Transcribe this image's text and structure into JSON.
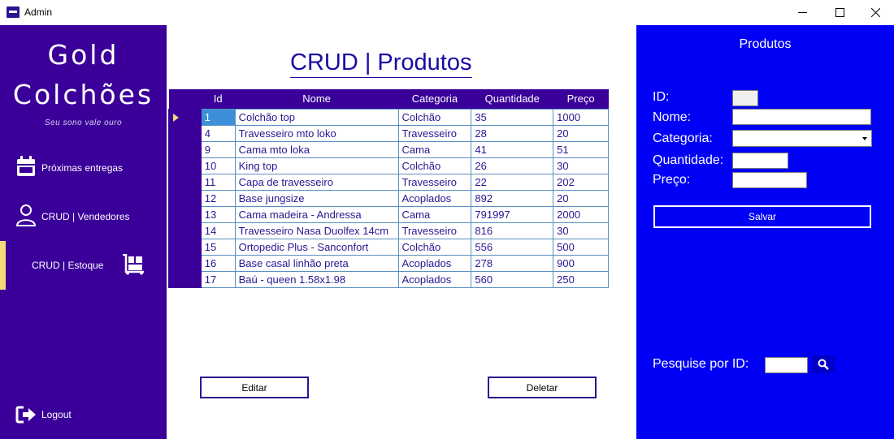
{
  "window": {
    "title": "Admin"
  },
  "sidebar": {
    "brand_line1": "Gold",
    "brand_line2": "Colchões",
    "tagline": "Seu sono vale ouro",
    "items": [
      {
        "label": "Próximas entregas",
        "icon": "calendar-icon",
        "active": false
      },
      {
        "label": "CRUD | Vendedores",
        "icon": "user-icon",
        "active": false
      },
      {
        "label": "CRUD | Estoque",
        "icon": "dolly-icon",
        "active": true
      }
    ],
    "logout_label": "Logout",
    "bg_color": "#3a0099",
    "active_marker_color": "#f5d97a"
  },
  "main": {
    "title": "CRUD | Produtos",
    "columns": [
      "Id",
      "Nome",
      "Categoria",
      "Quantidade",
      "Preço"
    ],
    "rows": [
      [
        "1",
        "Colchão top",
        "Colchão",
        "35",
        "1000"
      ],
      [
        "4",
        "Travesseiro mto loko",
        "Travesseiro",
        "28",
        "20"
      ],
      [
        "9",
        "Cama mto loka",
        "Cama",
        "41",
        "51"
      ],
      [
        "10",
        "King top",
        "Colchão",
        "26",
        "30"
      ],
      [
        "11",
        "Capa de travesseiro",
        "Travesseiro",
        "22",
        "202"
      ],
      [
        "12",
        "Base jungsize",
        "Acoplados",
        "892",
        "20"
      ],
      [
        "13",
        "Cama madeira - Andressa",
        "Cama",
        "791997",
        "2000"
      ],
      [
        "14",
        "Travesseiro Nasa Duolfex 14cm",
        "Travesseiro",
        "816",
        "30"
      ],
      [
        "15",
        "Ortopedic Plus - Sanconfort",
        "Colchão",
        "556",
        "500"
      ],
      [
        "16",
        "Base casal linhão preta",
        "Acoplados",
        "278",
        "900"
      ],
      [
        "17",
        "Baú - queen 1.58x1.98",
        "Acoplados",
        "560",
        "250"
      ]
    ],
    "selected_row": 0,
    "edit_label": "Editar",
    "delete_label": "Deletar"
  },
  "form": {
    "title": "Produtos",
    "id_label": "ID:",
    "id_value": "",
    "nome_label": "Nome:",
    "nome_value": "",
    "categoria_label": "Categoria:",
    "categoria_value": "",
    "quantidade_label": "Quantidade:",
    "quantidade_value": "",
    "preco_label": "Preço:",
    "preco_value": "",
    "save_label": "Salvar",
    "search_label": "Pesquise por ID:",
    "search_value": "",
    "bg_color": "#0000f5"
  }
}
